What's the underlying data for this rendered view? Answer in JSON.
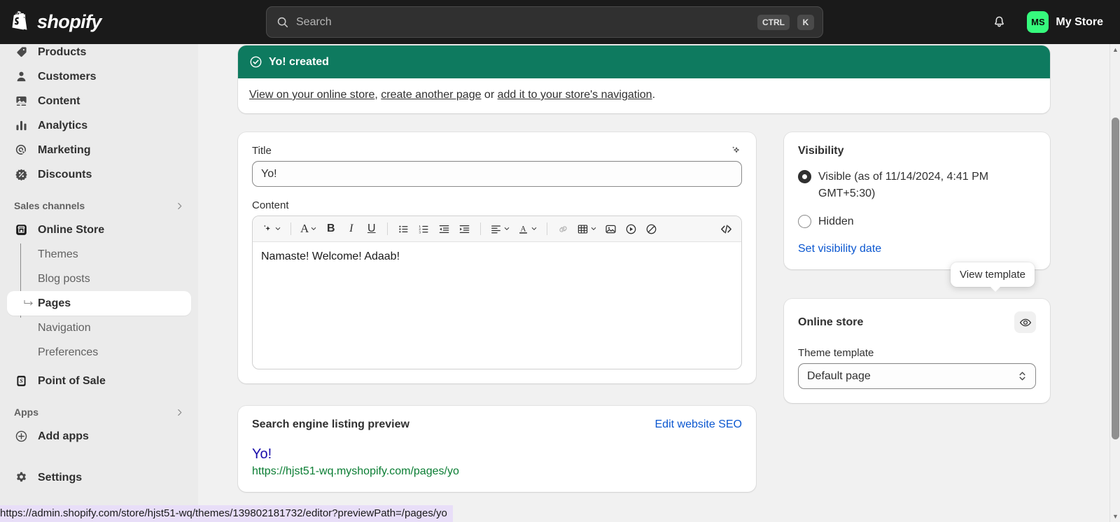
{
  "topbar": {
    "brand": "shopify",
    "search": {
      "placeholder": "Search",
      "value": "",
      "kbd1": "CTRL",
      "kbd2": "K"
    },
    "avatar_initials": "MS",
    "store_name": "My Store"
  },
  "sidebar": {
    "items": [
      {
        "label": "Products",
        "icon": "tag-icon"
      },
      {
        "label": "Customers",
        "icon": "person-icon"
      },
      {
        "label": "Content",
        "icon": "image-icon"
      },
      {
        "label": "Analytics",
        "icon": "bar-chart-icon"
      },
      {
        "label": "Marketing",
        "icon": "target-icon"
      },
      {
        "label": "Discounts",
        "icon": "discount-icon"
      }
    ],
    "sales_channels_label": "Sales channels",
    "online_store_label": "Online Store",
    "sub_items": [
      {
        "label": "Themes",
        "active": false
      },
      {
        "label": "Blog posts",
        "active": false
      },
      {
        "label": "Pages",
        "active": true
      },
      {
        "label": "Navigation",
        "active": false
      },
      {
        "label": "Preferences",
        "active": false
      }
    ],
    "point_of_sale_label": "Point of Sale",
    "apps_label": "Apps",
    "add_apps_label": "Add apps",
    "settings_label": "Settings"
  },
  "banner": {
    "heading": "Yo! created",
    "link_view": "View on your online store",
    "text_comma": ", ",
    "link_create": "create another page",
    "text_or": " or ",
    "link_add_nav": "add it to your store's navigation",
    "text_period": "."
  },
  "page_form": {
    "title_label": "Title",
    "title_value": "Yo!",
    "content_label": "Content",
    "content_value": "Namaste! Welcome! Adaab!",
    "toolbar": [
      {
        "name": "ai-sparkle-button",
        "glyph": "sparkle"
      },
      {
        "name": "text-style-button",
        "glyph": "A"
      },
      {
        "name": "bold-button",
        "glyph": "B"
      },
      {
        "name": "italic-button",
        "glyph": "I"
      },
      {
        "name": "underline-button",
        "glyph": "U"
      },
      {
        "name": "bulleted-list-button",
        "glyph": "bullets"
      },
      {
        "name": "numbered-list-button",
        "glyph": "numbers"
      },
      {
        "name": "outdent-button",
        "glyph": "outdent"
      },
      {
        "name": "indent-button",
        "glyph": "indent"
      },
      {
        "name": "align-button",
        "glyph": "align"
      },
      {
        "name": "text-color-button",
        "glyph": "color-A"
      },
      {
        "name": "link-button",
        "glyph": "link"
      },
      {
        "name": "table-button",
        "glyph": "table"
      },
      {
        "name": "insert-image-button",
        "glyph": "image"
      },
      {
        "name": "insert-video-button",
        "glyph": "video"
      },
      {
        "name": "clear-formatting-button",
        "glyph": "no"
      },
      {
        "name": "code-view-button",
        "glyph": "code"
      }
    ]
  },
  "visibility": {
    "title": "Visibility",
    "visible_label": "Visible (as of 11/14/2024, 4:41 PM GMT+5:30)",
    "hidden_label": "Hidden",
    "set_date_link": "Set visibility date",
    "selected": "visible"
  },
  "online_store": {
    "title": "Online store",
    "tooltip": "View template",
    "theme_template_label": "Theme template",
    "theme_template_value": "Default page"
  },
  "seo": {
    "title": "Search engine listing preview",
    "edit_link": "Edit website SEO",
    "preview_title": "Yo!",
    "preview_url": "https://hjst51-wq.myshopify.com/pages/yo"
  },
  "status_url": "https://admin.shopify.com/store/hjst51-wq/themes/139802181732/editor?previewPath=/pages/yo",
  "colors": {
    "topbar_bg": "#1a1a1a",
    "sidebar_bg": "#ebebeb",
    "banner_green": "#0e7a5f",
    "accent_blue": "#0b57d0",
    "avatar_green": "#36fa7d",
    "seo_url_green": "#0a7d33"
  }
}
